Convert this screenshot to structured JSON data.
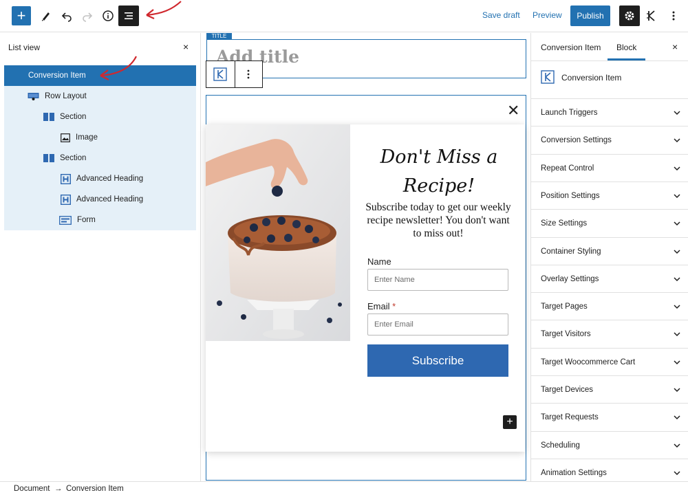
{
  "toolbar": {
    "add_symbol": "+",
    "save_draft": "Save draft",
    "preview": "Preview",
    "publish": "Publish"
  },
  "list_view": {
    "title": "List view",
    "close": "×",
    "items": [
      {
        "label": "Conversion Item",
        "selected": true
      },
      {
        "label": "Row Layout"
      },
      {
        "label": "Section"
      },
      {
        "label": "Image"
      },
      {
        "label": "Section"
      },
      {
        "label": "Advanced Heading"
      },
      {
        "label": "Advanced Heading"
      },
      {
        "label": "Form"
      }
    ]
  },
  "canvas": {
    "title_tag": "TITLE",
    "title_placeholder": "Add title",
    "close": "✕",
    "popup": {
      "heading_line1": "Don't Miss a",
      "heading_line2": "Recipe!",
      "subtext": "Subscribe today to get our weekly recipe newsletter! You don't want to miss out!",
      "name_label": "Name",
      "name_placeholder": "Enter Name",
      "email_label": "Email",
      "email_required": "*",
      "email_placeholder": "Enter Email",
      "subscribe": "Subscribe"
    },
    "add_symbol": "+"
  },
  "sidebar": {
    "tabs": [
      "Conversion Item",
      "Block"
    ],
    "active_tab": "Block",
    "close": "×",
    "block_name": "Conversion Item",
    "sections": [
      "Launch Triggers",
      "Conversion Settings",
      "Repeat Control",
      "Position Settings",
      "Size Settings",
      "Container Styling",
      "Overlay Settings",
      "Target Pages",
      "Target Visitors",
      "Target Woocommerce Cart",
      "Target Devices",
      "Target Requests",
      "Scheduling",
      "Animation Settings"
    ]
  },
  "breadcrumb": {
    "root": "Document",
    "separator": "→",
    "current": "Conversion Item"
  },
  "colors": {
    "accent": "#2271b1",
    "annotation_arrow": "#d0282e"
  }
}
